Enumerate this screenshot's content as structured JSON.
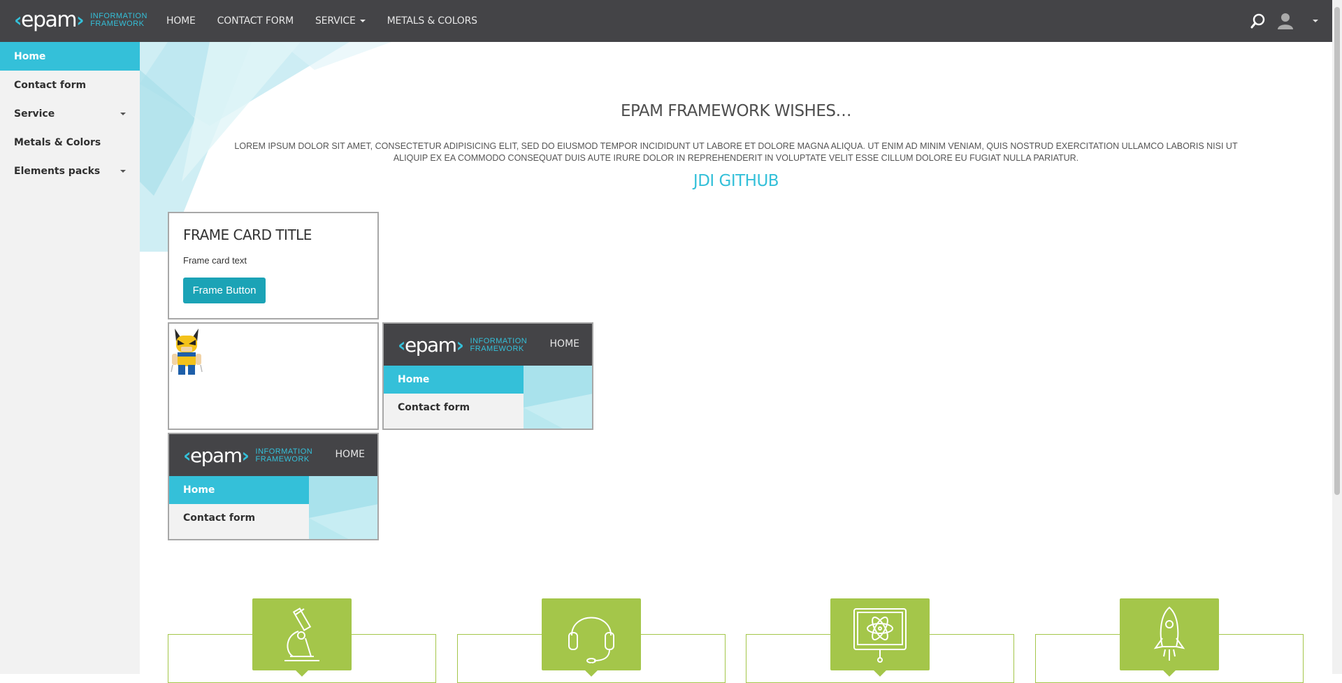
{
  "header": {
    "logo_word": "epam",
    "logo_sub_1": "INFORMATION",
    "logo_sub_2": "FRAMEWORK",
    "nav": [
      {
        "label": "HOME"
      },
      {
        "label": "CONTACT FORM"
      },
      {
        "label": "SERVICE"
      },
      {
        "label": "METALS & COLORS"
      }
    ],
    "icons": [
      "search-icon",
      "user-icon",
      "chevron-down-icon"
    ]
  },
  "sidebar": {
    "items": [
      {
        "label": "Home",
        "active": true
      },
      {
        "label": "Contact form"
      },
      {
        "label": "Service",
        "has_submenu": true
      },
      {
        "label": "Metals & Colors"
      },
      {
        "label": "Elements packs",
        "has_submenu": true
      }
    ]
  },
  "main": {
    "title": "EPAM FRAMEWORK WISHES…",
    "text": "LOREM IPSUM DOLOR SIT AMET, CONSECTETUR ADIPISICING ELIT, SED DO EIUSMOD TEMPOR INCIDIDUNT UT LABORE ET DOLORE MAGNA ALIQUA. UT ENIM AD MINIM VENIAM, QUIS NOSTRUD EXERCITATION ULLAMCO LABORIS NISI UT ALIQUIP EX EA COMMODO CONSEQUAT DUIS AUTE IRURE DOLOR IN REPREHENDERIT IN VOLUPTATE VELIT ESSE CILLUM DOLORE EU FUGIAT NULLA PARIATUR.",
    "link": "JDI GITHUB",
    "frame_card": {
      "title": "FRAME CARD TITLE",
      "text": "Frame card text",
      "button": "Frame Button"
    },
    "mini_frame": {
      "home": "HOME",
      "items": [
        "Home",
        "Contact form"
      ]
    },
    "benefits": [
      "microscope-icon",
      "headset-icon",
      "monitor-atom-icon",
      "rocket-icon"
    ]
  },
  "colors": {
    "header_bg": "#444447",
    "accent": "#34c0d9",
    "button": "#1ba3b6",
    "benefit_green": "#a4c64a",
    "sidebar_bg": "#f2f2f2"
  }
}
